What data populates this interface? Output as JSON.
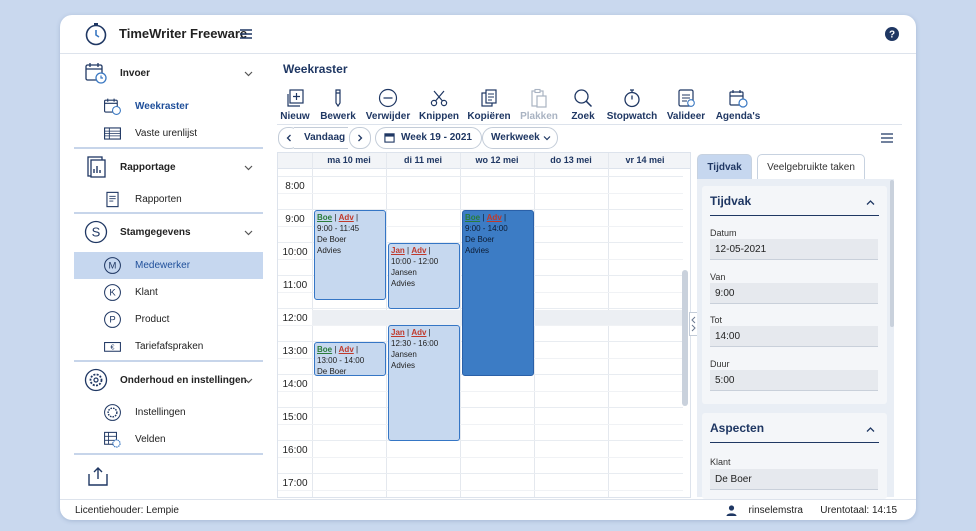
{
  "app": {
    "title": "TimeWriter Freeware"
  },
  "sidebar": {
    "groups": [
      {
        "label": "Invoer",
        "icon": "calendar-clock-icon",
        "items": [
          {
            "label": "Weekraster",
            "icon": "calendar-clock-icon",
            "active": false
          },
          {
            "label": "Vaste urenlijst",
            "icon": "table-list-icon",
            "active": false
          }
        ]
      },
      {
        "label": "Rapportage",
        "icon": "report-icon",
        "items": [
          {
            "label": "Rapporten",
            "icon": "report-icon",
            "active": false
          }
        ]
      },
      {
        "label": "Stamgegevens",
        "icon": "letter-s-icon",
        "items": [
          {
            "label": "Medewerker",
            "icon": "letter-m-icon",
            "active": true
          },
          {
            "label": "Klant",
            "icon": "letter-k-icon"
          },
          {
            "label": "Product",
            "icon": "letter-p-icon"
          },
          {
            "label": "Tariefafspraken",
            "icon": "euro-note-icon"
          }
        ]
      },
      {
        "label": "Onderhoud en instellingen",
        "icon": "gear-icon",
        "items": [
          {
            "label": "Instellingen",
            "icon": "gear-icon"
          },
          {
            "label": "Velden",
            "icon": "fields-gear-icon"
          }
        ]
      }
    ]
  },
  "main": {
    "title": "Weekraster"
  },
  "toolbar": [
    {
      "label": "Nieuw",
      "icon": "new-icon",
      "enabled": true
    },
    {
      "label": "Bewerk",
      "icon": "pencil-icon",
      "enabled": true
    },
    {
      "label": "Verwijder",
      "icon": "minus-circle-icon",
      "enabled": true
    },
    {
      "label": "Knippen",
      "icon": "scissors-icon",
      "enabled": true
    },
    {
      "label": "Kopiëren",
      "icon": "copy-icon",
      "enabled": true
    },
    {
      "label": "Plakken",
      "icon": "paste-icon",
      "enabled": false
    },
    {
      "label": "Zoek",
      "icon": "search-icon",
      "enabled": true
    },
    {
      "label": "Stopwatch",
      "icon": "stopwatch-icon",
      "enabled": true
    },
    {
      "label": "Valideer",
      "icon": "validate-icon",
      "enabled": true
    },
    {
      "label": "Agenda's",
      "icon": "agenda-icon",
      "enabled": true
    }
  ],
  "nav": {
    "today": "Vandaag",
    "week": "Week 19 - 2021",
    "view": "Werkweek"
  },
  "calendar": {
    "days": [
      "ma 10 mei",
      "di 11 mei",
      "wo 12 mei",
      "do 13 mei",
      "vr 14 mei"
    ],
    "hours": [
      "8:00",
      "9:00",
      "10:00",
      "11:00",
      "12:00",
      "13:00",
      "14:00",
      "15:00",
      "16:00",
      "17:00"
    ],
    "events": [
      {
        "day": 0,
        "start": "9:00",
        "end": "11:45",
        "client_code": "Boe",
        "product_code": "Adv",
        "time": "9:00 - 11:45",
        "client": "De Boer",
        "product": "Advies",
        "selected": false
      },
      {
        "day": 0,
        "start": "13:00",
        "end": "14:00",
        "client_code": "Boe",
        "product_code": "Adv",
        "time": "13:00 - 14:00",
        "client": "De Boer",
        "product": "",
        "selected": false
      },
      {
        "day": 1,
        "start": "10:00",
        "end": "12:00",
        "client_code": "Jan",
        "product_code": "Adv",
        "time": "10:00 - 12:00",
        "client": "Jansen",
        "product": "Advies",
        "selected": false
      },
      {
        "day": 1,
        "start": "12:30",
        "end": "16:00",
        "client_code": "Jan",
        "product_code": "Adv",
        "time": "12:30 - 16:00",
        "client": "Jansen",
        "product": "Advies",
        "selected": false
      },
      {
        "day": 2,
        "start": "9:00",
        "end": "14:00",
        "client_code": "Boe",
        "product_code": "Adv",
        "time": "9:00 - 14:00",
        "client": "De Boer",
        "product": "Advies",
        "selected": true
      }
    ]
  },
  "panel": {
    "tabs": [
      "Tijdvak",
      "Veelgebruikte taken"
    ],
    "tijdvak": {
      "title": "Tijdvak",
      "fields": [
        {
          "label": "Datum",
          "value": "12-05-2021"
        },
        {
          "label": "Van",
          "value": "9:00"
        },
        {
          "label": "Tot",
          "value": "14:00"
        },
        {
          "label": "Duur",
          "value": "5:00"
        }
      ]
    },
    "aspecten": {
      "title": "Aspecten",
      "fields": [
        {
          "label": "Klant",
          "value": "De Boer"
        }
      ]
    }
  },
  "status": {
    "license": "Licentiehouder: Lempie",
    "user": "rinselemstra",
    "total": "Urentotaal: 14:15"
  },
  "colors": {
    "accent": "#1f3763",
    "event_bg": "#c6d8ef",
    "event_selected": "#3c7cc5",
    "active_item": "#c6d7ef"
  }
}
